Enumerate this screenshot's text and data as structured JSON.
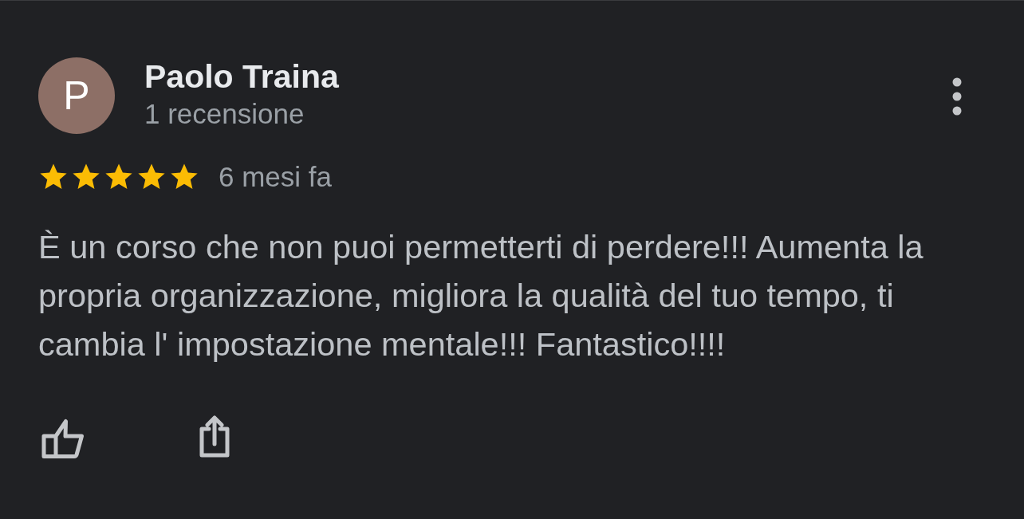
{
  "review": {
    "author": {
      "initial": "P",
      "name": "Paolo Traina",
      "review_count": "1 recensione"
    },
    "stars": 5,
    "time": "6 mesi fa",
    "text": "È un corso che non puoi permetterti di perdere!!! Aumenta la propria organizzazione, migliora la qualità del tuo tempo, ti cambia l' impostazione mentale!!! Fantastico!!!!"
  }
}
